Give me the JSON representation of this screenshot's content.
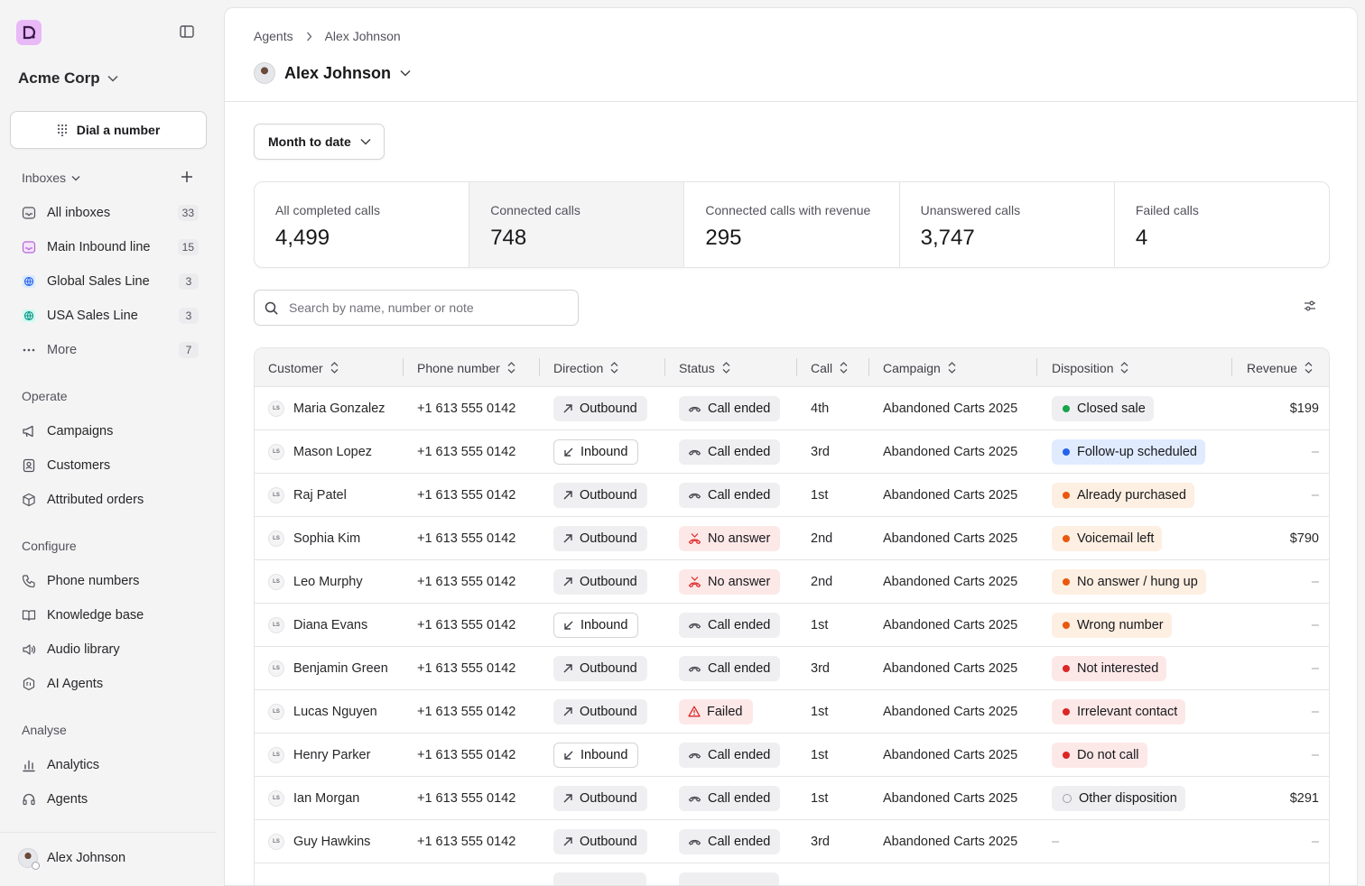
{
  "sidebar": {
    "org": "Acme Corp",
    "dial_label": "Dial a number",
    "inboxes_label": "Inboxes",
    "inboxes": [
      {
        "label": "All inboxes",
        "count": "33"
      },
      {
        "label": "Main Inbound line",
        "count": "15"
      },
      {
        "label": "Global Sales Line",
        "count": "3"
      },
      {
        "label": "USA Sales Line",
        "count": "3"
      },
      {
        "label": "More",
        "count": "7"
      }
    ],
    "operate_label": "Operate",
    "operate": [
      "Campaigns",
      "Customers",
      "Attributed orders"
    ],
    "configure_label": "Configure",
    "configure": [
      "Phone numbers",
      "Knowledge base",
      "Audio library",
      "AI Agents"
    ],
    "analyse_label": "Analyse",
    "analyse": [
      "Analytics",
      "Agents"
    ],
    "user": "Alex Johnson"
  },
  "header": {
    "breadcrumb": [
      "Agents",
      "Alex Johnson"
    ],
    "title": "Alex Johnson"
  },
  "range_label": "Month to date",
  "stats": [
    {
      "label": "All completed calls",
      "value": "4,499"
    },
    {
      "label": "Connected calls",
      "value": "748"
    },
    {
      "label": "Connected calls with revenue",
      "value": "295"
    },
    {
      "label": "Unanswered calls",
      "value": "3,747"
    },
    {
      "label": "Failed calls",
      "value": "4"
    }
  ],
  "search": {
    "placeholder": "Search by name, number or note"
  },
  "table": {
    "columns": [
      "Customer",
      "Phone number",
      "Direction",
      "Status",
      "Call",
      "Campaign",
      "Disposition",
      "Revenue"
    ],
    "rows": [
      {
        "initials": "LS",
        "customer": "Maria Gonzalez",
        "phone": "+1 613 555 0142",
        "direction": "Outbound",
        "status": "Call ended",
        "call": "4th",
        "campaign": "Abandoned Carts 2025",
        "disposition": "Closed sale",
        "revenue": "$199"
      },
      {
        "initials": "LS",
        "customer": "Mason Lopez",
        "phone": "+1 613 555 0142",
        "direction": "Inbound",
        "status": "Call ended",
        "call": "3rd",
        "campaign": "Abandoned Carts 2025",
        "disposition": "Follow-up scheduled",
        "revenue": "–"
      },
      {
        "initials": "LS",
        "customer": "Raj Patel",
        "phone": "+1 613 555 0142",
        "direction": "Outbound",
        "status": "Call ended",
        "call": "1st",
        "campaign": "Abandoned Carts 2025",
        "disposition": "Already purchased",
        "revenue": "–"
      },
      {
        "initials": "LS",
        "customer": "Sophia Kim",
        "phone": "+1 613 555 0142",
        "direction": "Outbound",
        "status": "No answer",
        "call": "2nd",
        "campaign": "Abandoned Carts 2025",
        "disposition": "Voicemail left",
        "revenue": "$790"
      },
      {
        "initials": "LS",
        "customer": "Leo Murphy",
        "phone": "+1 613 555 0142",
        "direction": "Outbound",
        "status": "No answer",
        "call": "2nd",
        "campaign": "Abandoned Carts 2025",
        "disposition": "No answer / hung up",
        "revenue": "–"
      },
      {
        "initials": "LS",
        "customer": "Diana Evans",
        "phone": "+1 613 555 0142",
        "direction": "Inbound",
        "status": "Call ended",
        "call": "1st",
        "campaign": "Abandoned Carts 2025",
        "disposition": "Wrong number",
        "revenue": "–"
      },
      {
        "initials": "LS",
        "customer": "Benjamin Green",
        "phone": "+1 613 555 0142",
        "direction": "Outbound",
        "status": "Call ended",
        "call": "3rd",
        "campaign": "Abandoned Carts 2025",
        "disposition": "Not interested",
        "revenue": "–"
      },
      {
        "initials": "LS",
        "customer": "Lucas Nguyen",
        "phone": "+1 613 555 0142",
        "direction": "Outbound",
        "status": "Failed",
        "call": "1st",
        "campaign": "Abandoned Carts 2025",
        "disposition": "Irrelevant contact",
        "revenue": "–"
      },
      {
        "initials": "LS",
        "customer": "Henry Parker",
        "phone": "+1 613 555 0142",
        "direction": "Inbound",
        "status": "Call ended",
        "call": "1st",
        "campaign": "Abandoned Carts 2025",
        "disposition": "Do not call",
        "revenue": "–"
      },
      {
        "initials": "LS",
        "customer": "Ian Morgan",
        "phone": "+1 613 555 0142",
        "direction": "Outbound",
        "status": "Call ended",
        "call": "1st",
        "campaign": "Abandoned Carts 2025",
        "disposition": "Other disposition",
        "revenue": "$291"
      },
      {
        "initials": "LS",
        "customer": "Guy Hawkins",
        "phone": "+1 613 555 0142",
        "direction": "Outbound",
        "status": "Call ended",
        "call": "3rd",
        "campaign": "Abandoned Carts 2025",
        "disposition": "–",
        "revenue": "–"
      }
    ]
  },
  "colors": {
    "accent": "#e9b8f6",
    "disp_green": "#16a34a",
    "disp_blue": "#2563eb",
    "disp_orange": "#ea580c",
    "disp_red": "#dc2626",
    "bg_blue": "#e0ebff",
    "bg_orange": "#fdefe2",
    "bg_red": "#fde8e8",
    "bg_gray": "#efeff1"
  }
}
